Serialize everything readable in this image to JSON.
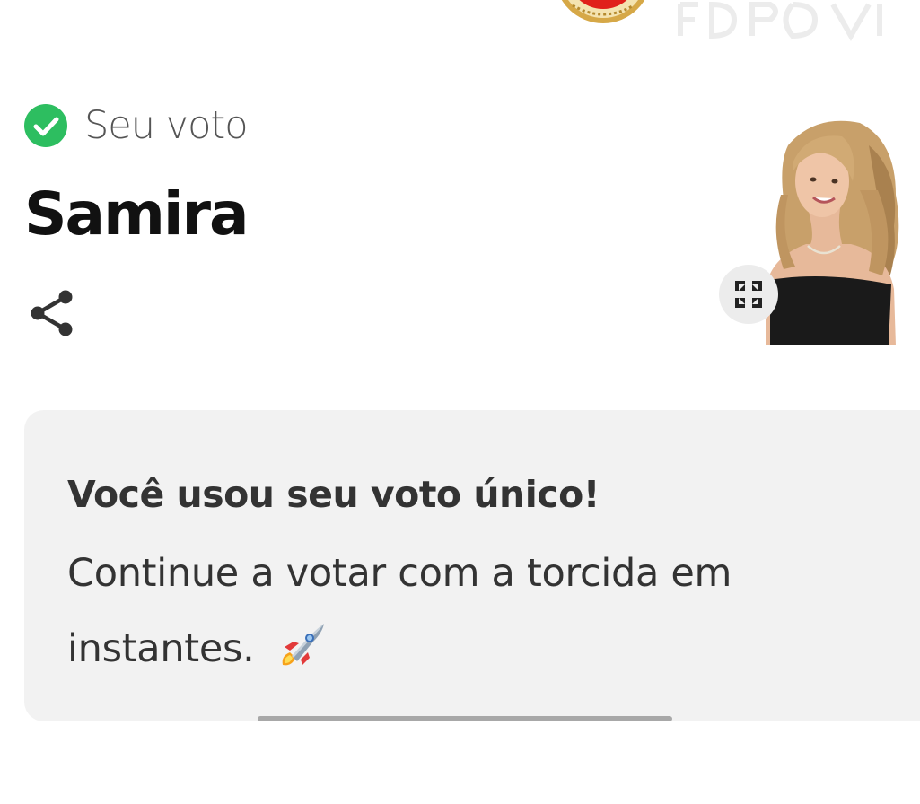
{
  "header": {
    "logo_icon": "seal-logo-icon",
    "watermark_icon": "faded-brand-watermark"
  },
  "vote": {
    "status_icon": "check-circle-icon",
    "status_color": "#2dbe60",
    "label": "Seu voto",
    "candidate_name": "Samira"
  },
  "actions": {
    "share_icon": "share-icon",
    "expand_icon": "expand-arrows-icon"
  },
  "card": {
    "title": "Você usou seu voto único!",
    "message": "Continue a votar com a torcida em instantes.",
    "emoji_icon": "rocket-icon"
  },
  "colors": {
    "card_background": "#f2f2f2",
    "text_primary": "#111111",
    "text_secondary": "#555555",
    "logo_red": "#e0201b",
    "logo_gold": "#d6a847"
  }
}
